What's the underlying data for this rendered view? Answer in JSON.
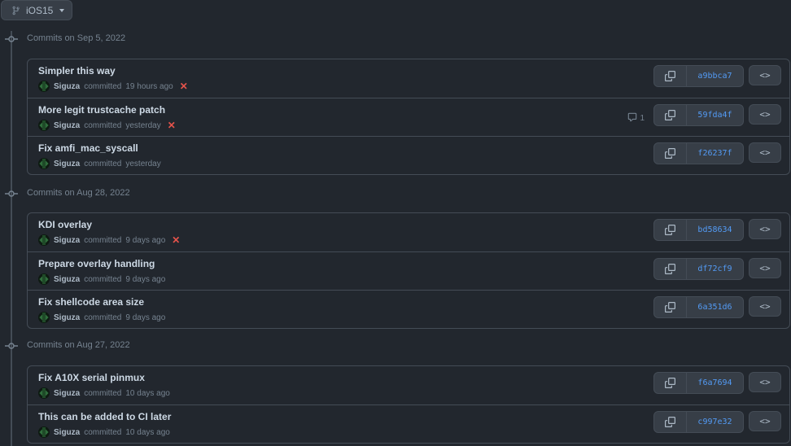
{
  "branch": {
    "name": "iOS15"
  },
  "groups": [
    {
      "header": "Commits on Sep 5, 2022",
      "commits": [
        {
          "title": "Simpler this way",
          "author": "Siguza",
          "action": "committed",
          "time": "19 hours ago",
          "status": "failed",
          "sha": "a9bbca7"
        },
        {
          "title": "More legit trustcache patch",
          "author": "Siguza",
          "action": "committed",
          "time": "yesterday",
          "status": "failed",
          "sha": "59fda4f",
          "comments": "1"
        },
        {
          "title": "Fix amfi_mac_syscall",
          "author": "Siguza",
          "action": "committed",
          "time": "yesterday",
          "status": "",
          "sha": "f26237f"
        }
      ]
    },
    {
      "header": "Commits on Aug 28, 2022",
      "commits": [
        {
          "title": "KDI overlay",
          "author": "Siguza",
          "action": "committed",
          "time": "9 days ago",
          "status": "failed",
          "sha": "bd58634"
        },
        {
          "title": "Prepare overlay handling",
          "author": "Siguza",
          "action": "committed",
          "time": "9 days ago",
          "status": "",
          "sha": "df72cf9"
        },
        {
          "title": "Fix shellcode area size",
          "author": "Siguza",
          "action": "committed",
          "time": "9 days ago",
          "status": "",
          "sha": "6a351d6"
        }
      ]
    },
    {
      "header": "Commits on Aug 27, 2022",
      "commits": [
        {
          "title": "Fix A10X serial pinmux",
          "author": "Siguza",
          "action": "committed",
          "time": "10 days ago",
          "status": "",
          "sha": "f6a7694"
        },
        {
          "title": "This can be added to CI later",
          "author": "Siguza",
          "action": "committed",
          "time": "10 days ago",
          "status": "",
          "sha": "c997e32"
        }
      ]
    }
  ],
  "icons": {
    "branch": "git-branch-icon",
    "commit": "git-commit-icon",
    "copy": "copy-icon",
    "browse": "code-icon",
    "comment": "comment-icon",
    "failed": "x-icon"
  },
  "colors": {
    "background": "#22272e",
    "sha": "#539bf5",
    "failed": "#e5534b"
  }
}
